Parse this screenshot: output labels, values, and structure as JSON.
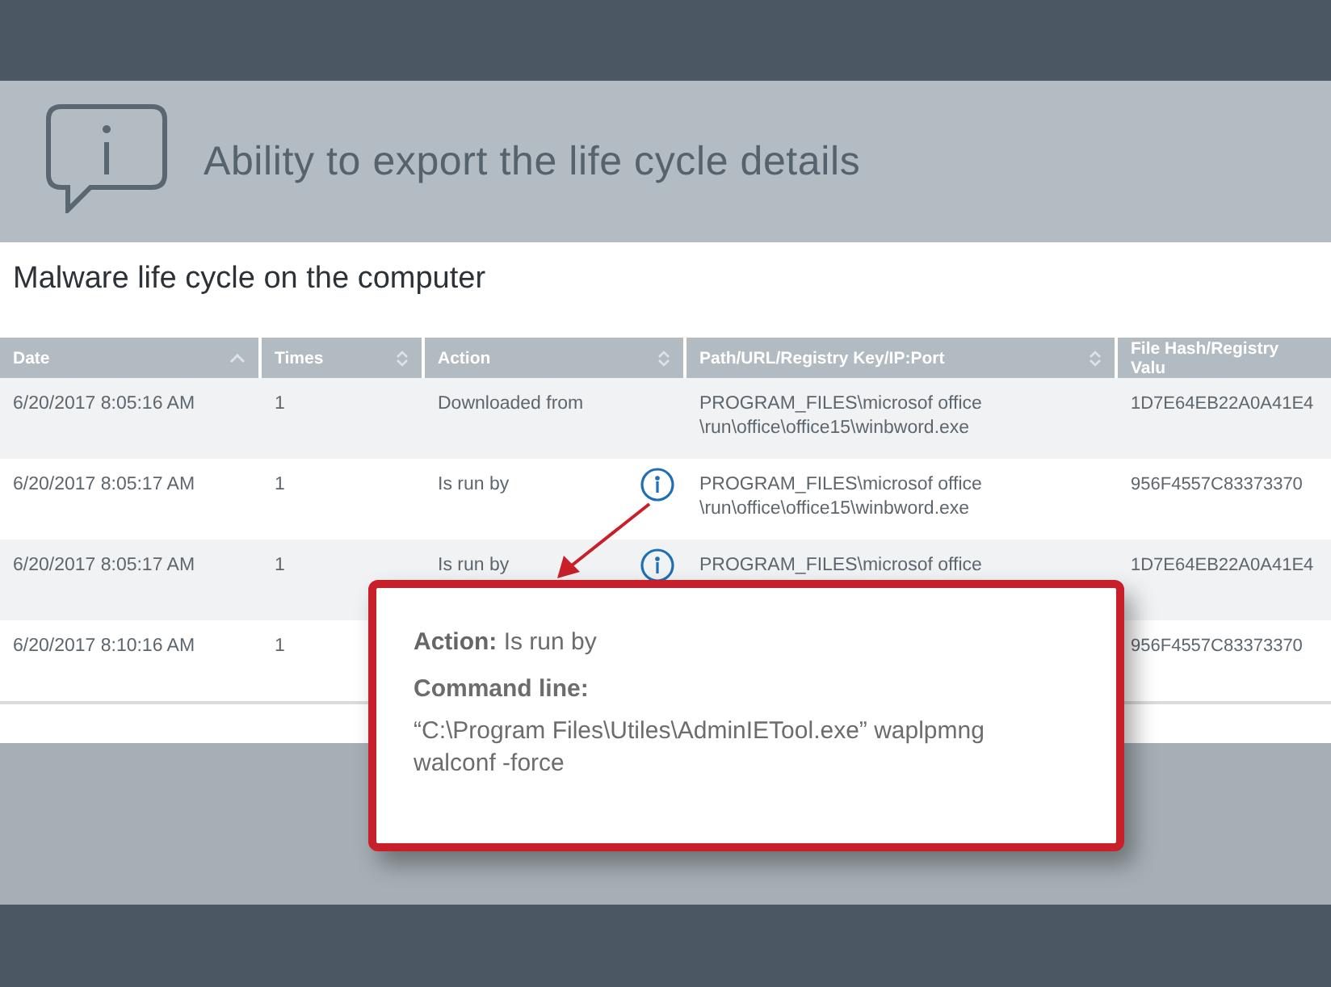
{
  "banner": {
    "title": "Ability to export the life cycle details"
  },
  "panel": {
    "title": "Malware life cycle on the computer"
  },
  "table": {
    "columns": [
      {
        "label": "Date",
        "sorted": true
      },
      {
        "label": "Times",
        "sorted": false
      },
      {
        "label": "Action",
        "sorted": false
      },
      {
        "label": "Path/URL/Registry Key/IP:Port",
        "sorted": false
      },
      {
        "label": "File Hash/Registry Valu"
      }
    ],
    "rows": [
      {
        "date": "6/20/2017 8:05:16 AM",
        "times": "1",
        "action": "Downloaded from",
        "info": false,
        "path": [
          "PROGRAM_FILES\\microsof office",
          "\\run\\office\\office15\\winbword.exe"
        ],
        "hash": "1D7E64EB22A0A41E4"
      },
      {
        "date": "6/20/2017 8:05:17 AM",
        "times": "1",
        "action": "Is run by",
        "info": true,
        "path": [
          "PROGRAM_FILES\\microsof office",
          "\\run\\office\\office15\\winbword.exe"
        ],
        "hash": "956F4557C83373370"
      },
      {
        "date": "6/20/2017 8:05:17 AM",
        "times": "1",
        "action": "Is run by",
        "info": true,
        "path": [
          "PROGRAM_FILES\\microsof office"
        ],
        "hash": "1D7E64EB22A0A41E4"
      },
      {
        "date": "6/20/2017 8:10:16 AM",
        "times": "1",
        "hash": "956F4557C83373370"
      }
    ]
  },
  "tooltip": {
    "action_label": "Action:",
    "action_value": "Is run by",
    "command_label": "Command line:",
    "command_value": "“C:\\Program Files\\Utiles\\AdminIETool.exe” waplpmng walconf -force"
  }
}
